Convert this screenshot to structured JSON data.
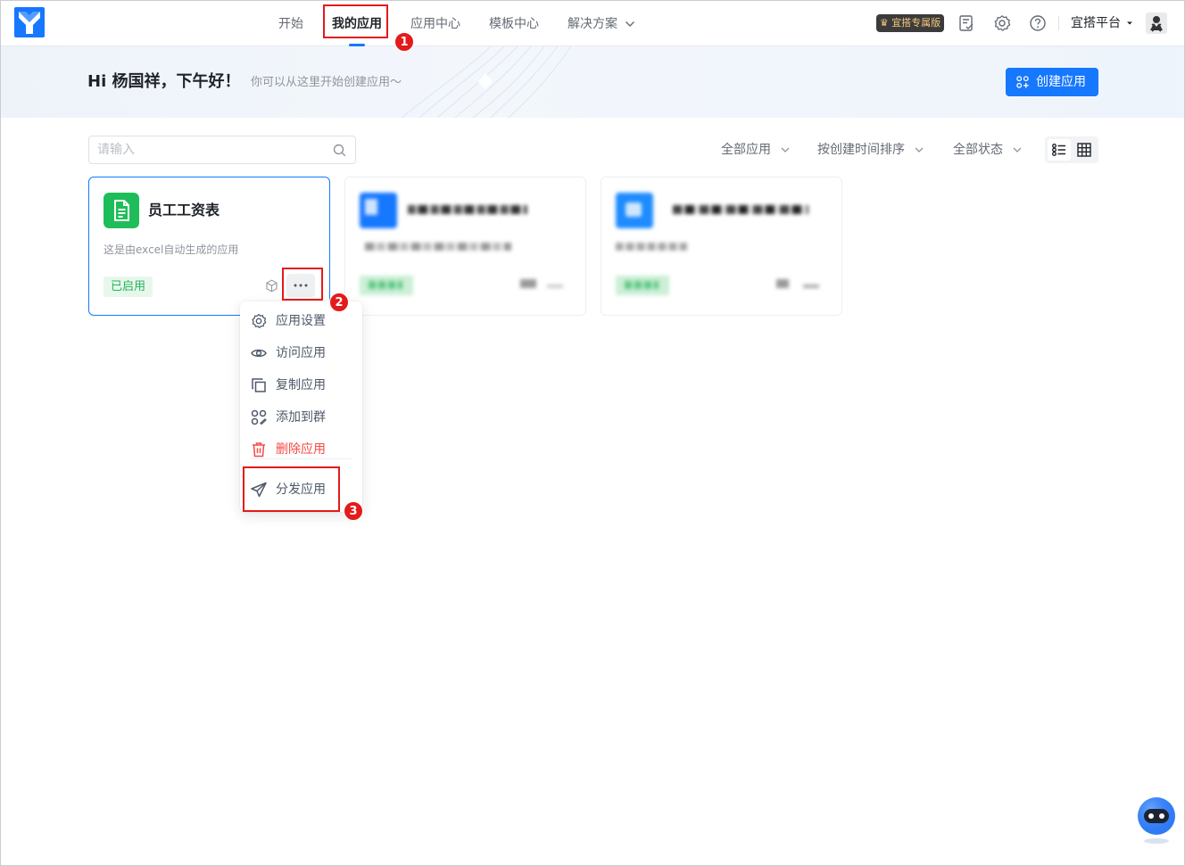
{
  "nav": {
    "items": [
      {
        "label": "开始"
      },
      {
        "label": "我的应用"
      },
      {
        "label": "应用中心"
      },
      {
        "label": "模板中心"
      },
      {
        "label": "解决方案"
      }
    ]
  },
  "header": {
    "pro_badge": "宜搭专属版",
    "platform_label": "宜搭平台",
    "accent_color": "#1677ff"
  },
  "banner": {
    "greeting": "Hi 杨国祥，下午好！",
    "subtitle": "你可以从这里开始创建应用～",
    "create_button": "创建应用"
  },
  "toolbar": {
    "search_placeholder": "请输入",
    "filter_apps": "全部应用",
    "sort": "按创建时间排序",
    "filter_status": "全部状态"
  },
  "cards": [
    {
      "title": "员工工资表",
      "description": "这是由excel自动生成的应用",
      "status": "已启用",
      "icon": "document-icon",
      "icon_color": "#1fbd5a"
    }
  ],
  "context_menu": {
    "items": [
      {
        "label": "应用设置",
        "icon": "gear-icon"
      },
      {
        "label": "访问应用",
        "icon": "eye-icon"
      },
      {
        "label": "复制应用",
        "icon": "copy-icon"
      },
      {
        "label": "添加到群",
        "icon": "group-add-icon"
      },
      {
        "label": "删除应用",
        "icon": "trash-icon"
      },
      {
        "label": "分发应用",
        "icon": "send-icon"
      }
    ]
  },
  "annotations": {
    "steps": [
      "1",
      "2",
      "3"
    ],
    "color": "#e31b1b"
  }
}
